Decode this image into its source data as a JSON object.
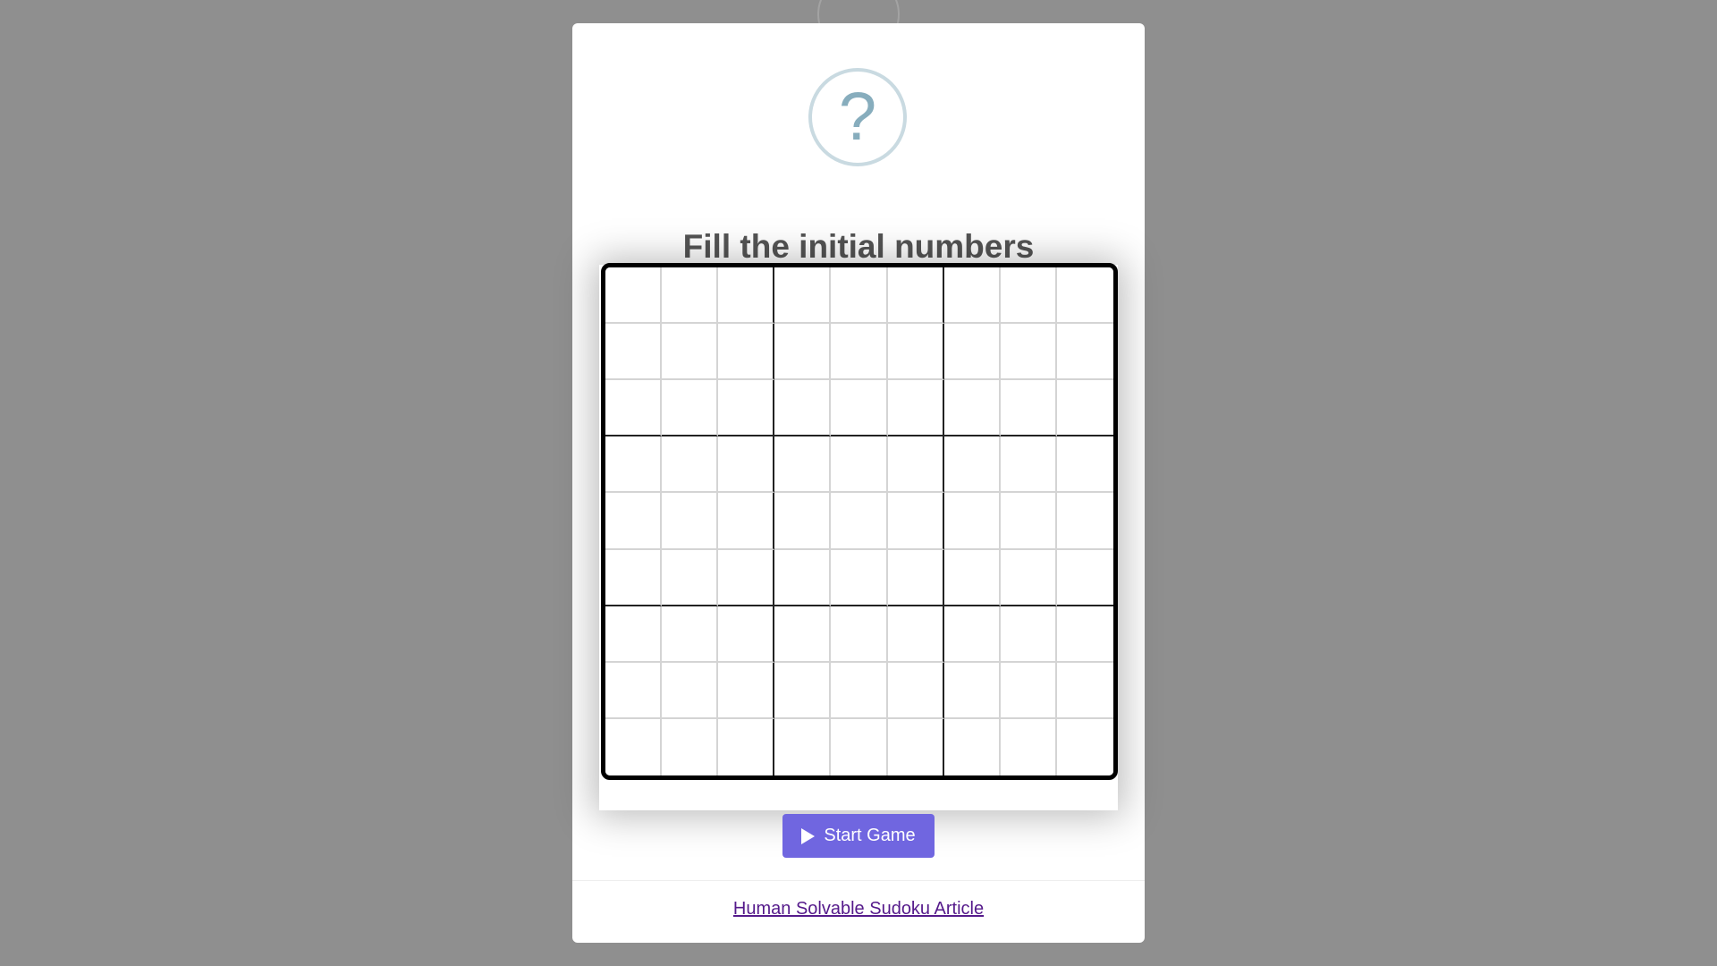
{
  "dialog": {
    "icon_glyph": "?",
    "title": "Fill the initial numbers",
    "start_button_label": "Start Game",
    "footer_link_label": "Human Solvable Sudoku Article"
  },
  "board": {
    "rows": 9,
    "cols": 9,
    "cells": [
      [
        "",
        "",
        "",
        "",
        "",
        "",
        "",
        "",
        ""
      ],
      [
        "",
        "",
        "",
        "",
        "",
        "",
        "",
        "",
        ""
      ],
      [
        "",
        "",
        "",
        "",
        "",
        "",
        "",
        "",
        ""
      ],
      [
        "",
        "",
        "",
        "",
        "",
        "",
        "",
        "",
        ""
      ],
      [
        "",
        "",
        "",
        "",
        "",
        "",
        "",
        "",
        ""
      ],
      [
        "",
        "",
        "",
        "",
        "",
        "",
        "",
        "",
        ""
      ],
      [
        "",
        "",
        "",
        "",
        "",
        "",
        "",
        "",
        ""
      ],
      [
        "",
        "",
        "",
        "",
        "",
        "",
        "",
        "",
        ""
      ],
      [
        "",
        "",
        "",
        "",
        "",
        "",
        "",
        "",
        ""
      ]
    ]
  },
  "colors": {
    "overlay": "#8f8f8f",
    "button": "#7066e0",
    "icon": "#87adbd",
    "icon_ring": "#c9dae1",
    "title": "#545454",
    "link": "#551a8b"
  },
  "icons": {
    "dialog_icon": "question-icon",
    "button_icon": "play-icon"
  }
}
